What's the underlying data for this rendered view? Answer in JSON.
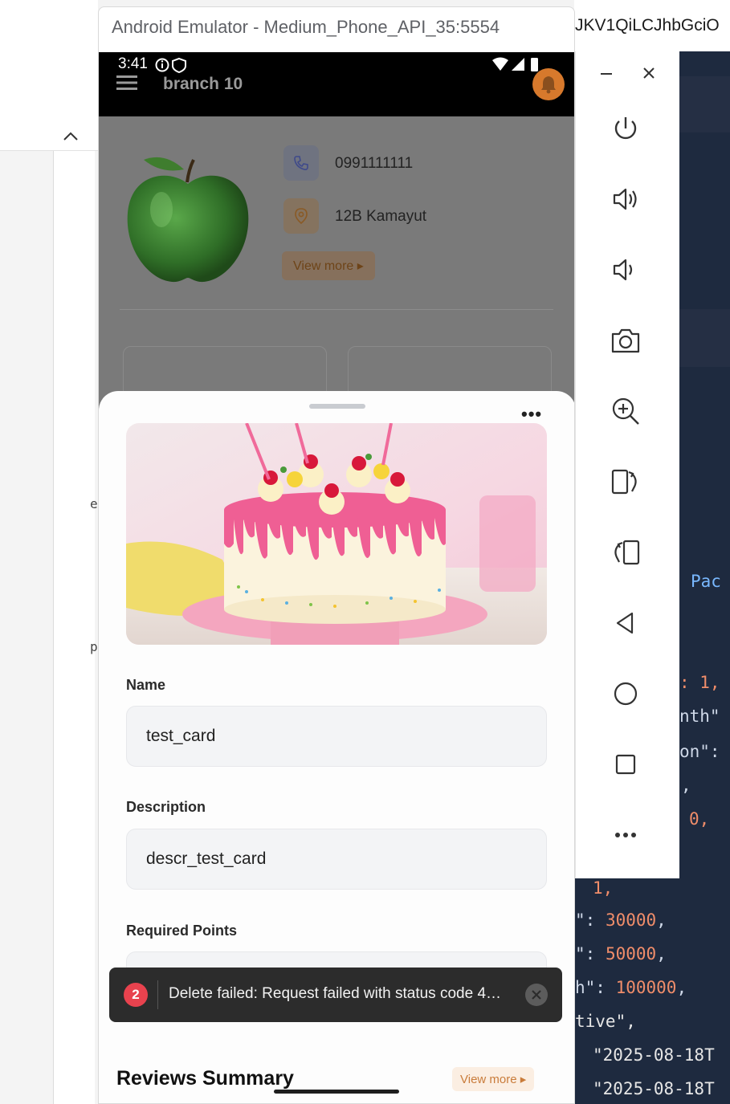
{
  "emulator": {
    "window_title": "Android Emulator - Medium_Phone_API_35:5554"
  },
  "background_editor": {
    "top_text": "JKV1QiLCJhbGciO",
    "fragments": [
      {
        "id": "pac",
        "text": "Pac"
      },
      {
        "id": "f1",
        "text": ": 1,"
      },
      {
        "id": "f2",
        "text": "nth\""
      },
      {
        "id": "f3",
        "text": "on\":"
      },
      {
        "id": "f4",
        "text": ","
      },
      {
        "id": "f5",
        "text": "0,"
      },
      {
        "id": "f6",
        "text": "1,"
      },
      {
        "id": "f7",
        "text": "\": 30000,"
      },
      {
        "id": "f8",
        "text": "\": 50000,"
      },
      {
        "id": "f9",
        "text": "h\": 100000,"
      },
      {
        "id": "f10",
        "text": "tive\","
      },
      {
        "id": "f11",
        "text": "\"2025-08-18T"
      },
      {
        "id": "f12",
        "text": "\"2025-08-18T"
      }
    ],
    "left_fragments": [
      "e",
      "p"
    ]
  },
  "status_bar": {
    "time": "3:41"
  },
  "app_bar": {
    "title": "branch 10"
  },
  "branch": {
    "phone": "0991111111",
    "address": "12B Kamayut",
    "view_more": "View more ▸"
  },
  "sheet": {
    "more_label": "•••",
    "fields": [
      {
        "label": "Name",
        "value": "test_card"
      },
      {
        "label": "Description",
        "value": "descr_test_card"
      },
      {
        "label": "Required Points",
        "value": ""
      }
    ],
    "reviews_title": "Reviews Summary",
    "reviews_more": "View more ▸"
  },
  "toast": {
    "count": "2",
    "message": "Delete failed: Request failed with status code 4…"
  },
  "colors": {
    "accent_orange": "#d7792c",
    "toast_badge": "#e8424e",
    "editor_bg": "#1e2a3f"
  }
}
